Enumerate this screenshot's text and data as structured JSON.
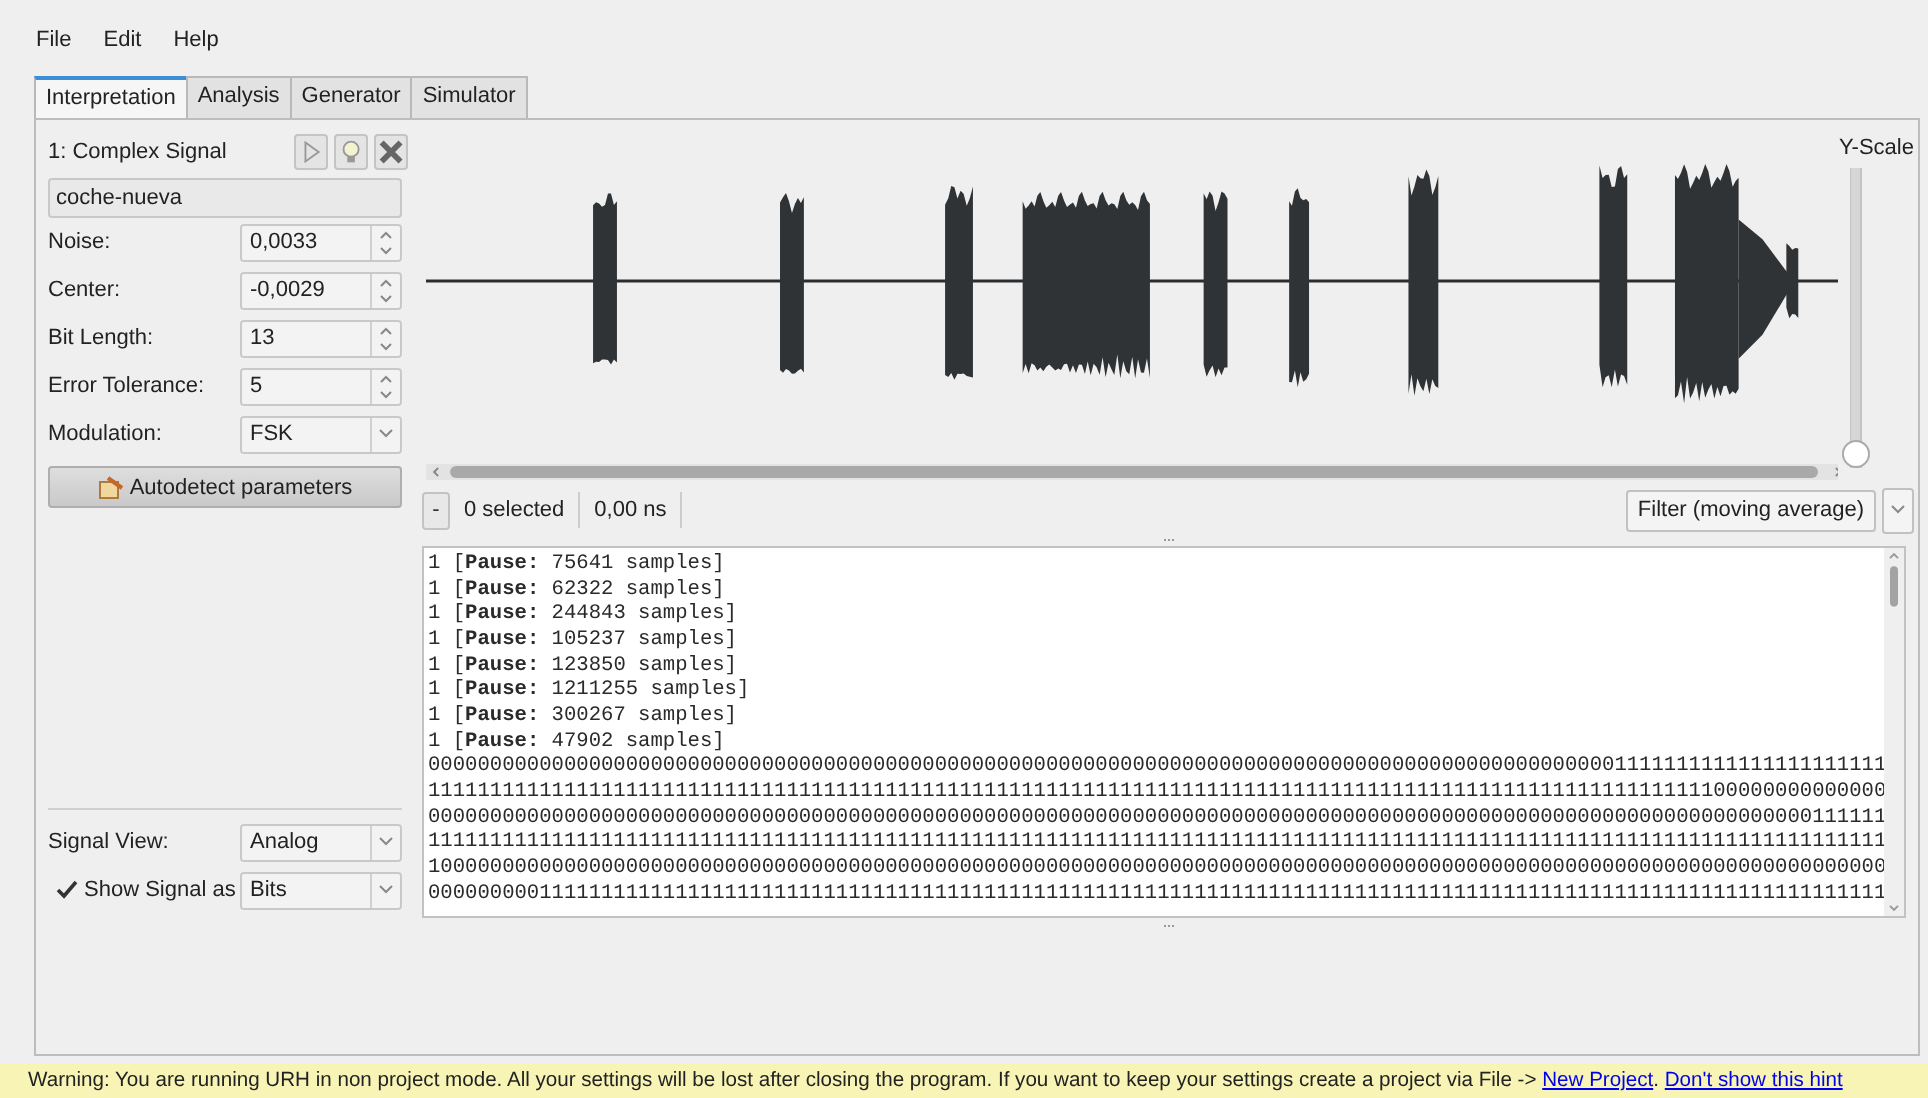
{
  "menu": [
    "File",
    "Edit",
    "Help"
  ],
  "tabs": [
    {
      "label": "Interpretation",
      "selected": true
    },
    {
      "label": "Analysis",
      "selected": false
    },
    {
      "label": "Generator",
      "selected": false
    },
    {
      "label": "Simulator",
      "selected": false
    }
  ],
  "signal": {
    "title": "1: Complex Signal",
    "name": "coche-nueva",
    "params": [
      {
        "label": "Noise:",
        "value": "0,0033",
        "kind": "spin"
      },
      {
        "label": "Center:",
        "value": "-0,0029",
        "kind": "spin"
      },
      {
        "label": "Bit Length:",
        "value": "13",
        "kind": "spin"
      },
      {
        "label": "Error Tolerance:",
        "value": "5",
        "kind": "spin"
      },
      {
        "label": "Modulation:",
        "value": "FSK",
        "kind": "combo"
      }
    ],
    "autodetect": "Autodetect parameters",
    "signal_view": {
      "label": "Signal View:",
      "value": "Analog"
    },
    "show_signal": {
      "label": "Show Signal as",
      "checked": true,
      "value": "Bits"
    }
  },
  "graph": {
    "yscale_label": "Y-Scale",
    "yscale": {
      "level": 0
    }
  },
  "toolbar": {
    "minus": "-",
    "selected": "0 selected",
    "time": "0,00 ns",
    "filter": "Filter (moving average)"
  },
  "output": {
    "lines": [
      "1 [**Pause:** 75641 samples]",
      "1 [**Pause:** 62322 samples]",
      "1 [**Pause:** 244843 samples]",
      "1 [**Pause:** 105237 samples]",
      "1 [**Pause:** 123850 samples]",
      "1 [**Pause:** 1211255 samples]",
      "1 [**Pause:** 300267 samples]",
      "1 [**Pause:** 47902 samples]",
      "0000000000000000000000000000000000000000000000000000000000000000000000000000000000000000000000001111111111111111111111",
      "1111111111111111111111111111111111111111111111111111111111111111111111111111111111111111111111111111111100000000000000",
      "0000000000000000000000000000000000000000000000000000000000000000000000000000000000000000000000000000000000000000111111",
      "1111111111111111111111111111111111111111111111111111111111111111111111111111111111111111111111111111111111111111111111",
      "1000000000000000000000000000000000000000000000000000000000000000000000000000000000000000000000000000000000000000000000",
      "0000000001111111111111111111111111111111111111111111111111111111111111111111111111111111111111111111111111111111111111"
    ]
  },
  "warning": {
    "text": "Warning: You are running URH in non project mode. All your settings will be lost after closing the program. If you want to keep your settings create a project via File -> ",
    "link": "New Project",
    "after": ".",
    "hint_link": "Don't show this hint"
  }
}
